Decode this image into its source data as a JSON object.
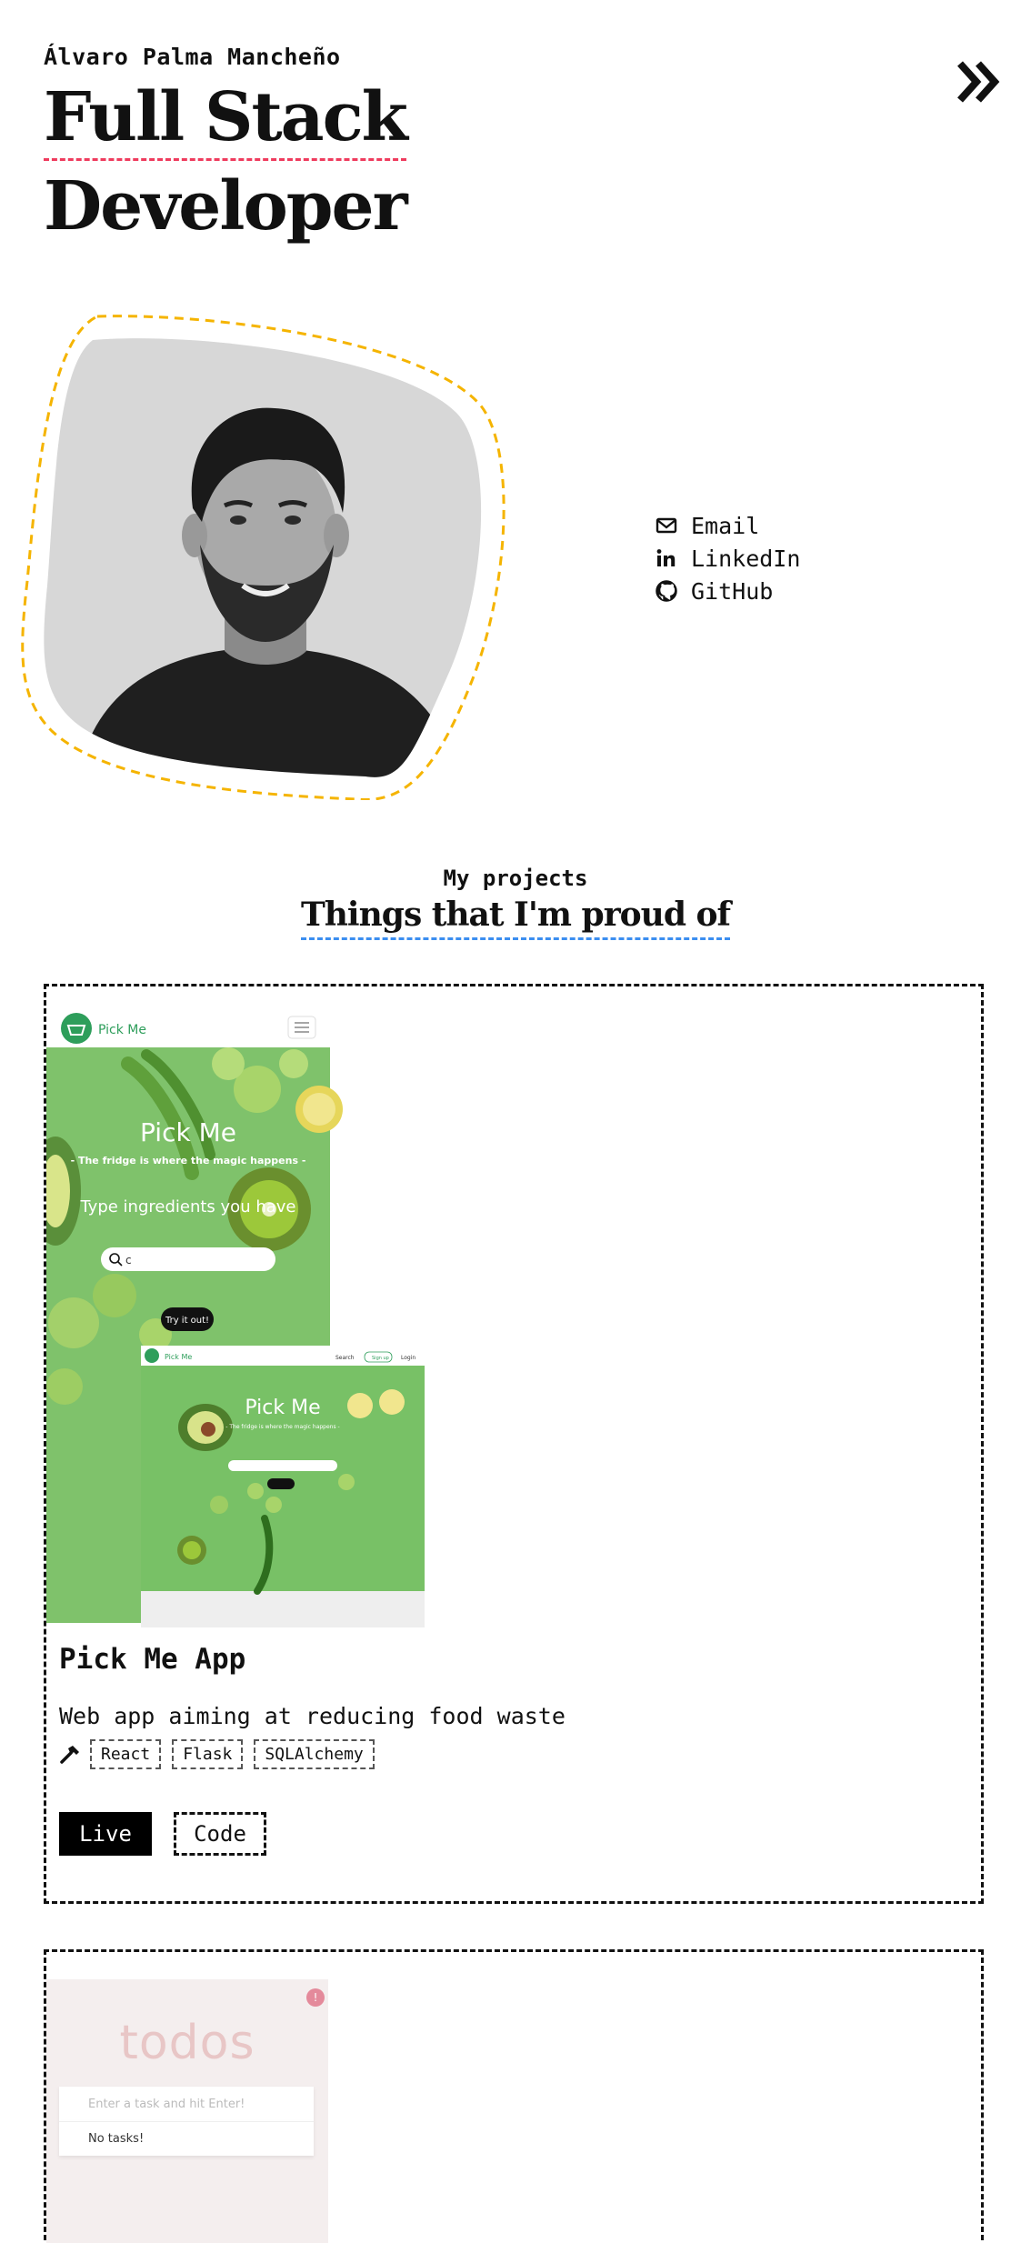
{
  "header": {
    "name": "Álvaro Palma Mancheño",
    "title_line1": "Full Stack",
    "title_line2": "Developer",
    "menu_icon": "double-chevron-right-icon"
  },
  "profile": {
    "photo_alt": "portrait"
  },
  "contact_links": [
    {
      "label": "Email",
      "icon": "envelope-icon"
    },
    {
      "label": "LinkedIn",
      "icon": "linkedin-icon"
    },
    {
      "label": "GitHub",
      "icon": "github-icon"
    }
  ],
  "projects_section": {
    "subtitle": "My projects",
    "title": "Things that I'm proud of"
  },
  "projects": [
    {
      "title": "Pick Me App",
      "description": "Web app aiming at reducing food waste",
      "tech": [
        "React",
        "Flask",
        "SQLAlchemy"
      ],
      "live_label": "Live",
      "code_label": "Code",
      "screenshot": {
        "brand": "Pick Me",
        "hero_title": "Pick Me",
        "tagline": "- The fridge is where the magic happens -",
        "prompt": "Type ingredients you have",
        "search_value": "c",
        "cta": "Try it out!",
        "nav_search": "Search",
        "nav_signup": "Sign up",
        "nav_login": "Login"
      }
    },
    {
      "screenshot": {
        "app_title": "todos",
        "input_placeholder": "Enter a task and hit Enter!",
        "empty_text": "No tasks!",
        "badge": "!"
      }
    }
  ],
  "colors": {
    "title_underline": "#ef3b5d",
    "section_underline": "#3b8ef0",
    "portrait_outline": "#f5b400",
    "pickme_green": "#2e9e5b"
  }
}
